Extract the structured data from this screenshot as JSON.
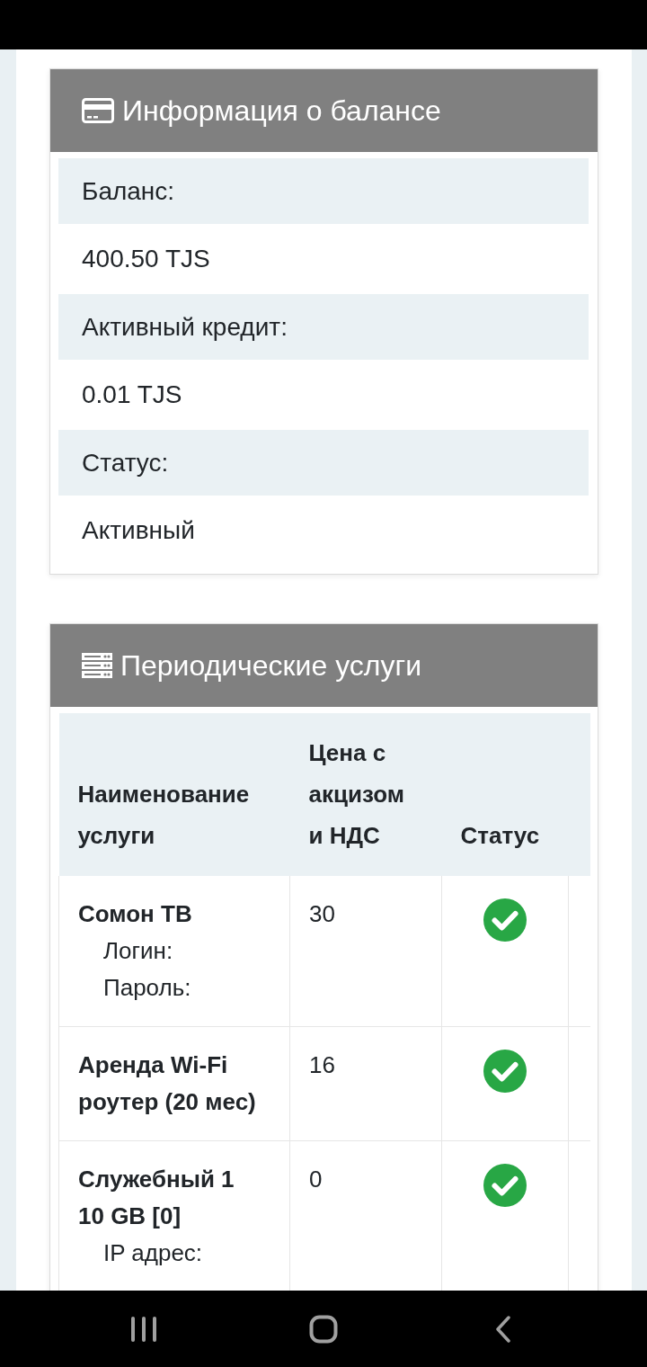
{
  "balance_card": {
    "title": "Информация о балансе",
    "rows": [
      {
        "label": "Баланс:",
        "value": "400.50 TJS"
      },
      {
        "label": "Активный кредит:",
        "value": "0.01 TJS"
      },
      {
        "label": "Статус:",
        "value": "Активный"
      }
    ]
  },
  "services_card": {
    "title": "Периодические услуги",
    "table": {
      "columns": [
        "Наименование услуги",
        "Цена с акцизом и НДС",
        "Статус"
      ],
      "rows": [
        {
          "name": "Сомон ТВ",
          "details": [
            "Логин:",
            "Пароль:"
          ],
          "price": "30",
          "active": true
        },
        {
          "name": "Аренда Wi-Fi роутер (20 мес)",
          "price": "16",
          "active": true
        },
        {
          "name": "Служебный 1 10 GB [0]",
          "details": [
            "IP адрес:"
          ],
          "price": "0",
          "active": true
        }
      ]
    }
  }
}
